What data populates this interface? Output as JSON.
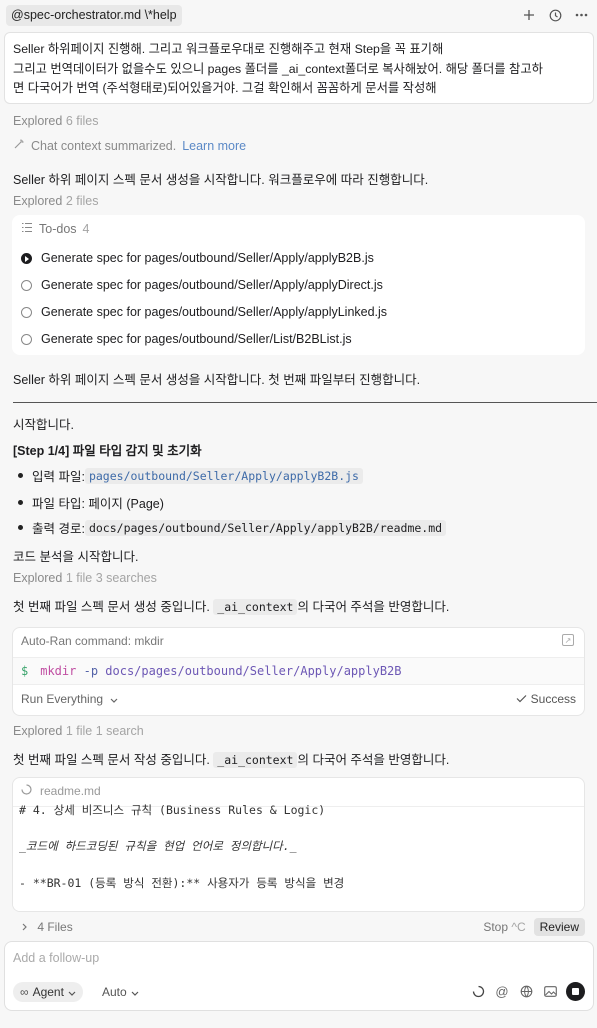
{
  "header": {
    "tab_title": "@spec-orchestrator.md \\*help",
    "icons": [
      "plus-icon",
      "history-icon",
      "more-icon"
    ]
  },
  "user_message": {
    "lines": [
      "Seller 하위페이지 진행해. 그리고 워크플로우대로 진행해주고 현재 Step을 꼭 표기해",
      "그리고 번역데이터가 없을수도 있으니 pages 폴더를 _ai_context폴더로 복사해놨어. 해당 폴더를 참고하",
      "면 다국어가 번역 (주석형태로)되어있을거야. 그걸 확인해서 꼼꼼하게 문서를 작성해"
    ]
  },
  "explored_1": {
    "label": "Explored",
    "detail": "6 files"
  },
  "summary": {
    "text": "Chat context summarized.",
    "link": "Learn more"
  },
  "msg_1": "Seller 하위 페이지 스펙 문서 생성을 시작합니다. 워크플로우에 따라 진행합니다.",
  "explored_2": {
    "label": "Explored",
    "detail": "2 files"
  },
  "todos": {
    "title": "To-dos",
    "count": "4",
    "items": [
      {
        "label": "Generate spec for pages/outbound/Seller/Apply/applyB2B.js",
        "state": "in-progress"
      },
      {
        "label": "Generate spec for pages/outbound/Seller/Apply/applyDirect.js",
        "state": "pending"
      },
      {
        "label": "Generate spec for pages/outbound/Seller/Apply/applyLinked.js",
        "state": "pending"
      },
      {
        "label": "Generate spec for pages/outbound/Seller/List/B2BList.js",
        "state": "pending"
      }
    ]
  },
  "msg_2": "Seller 하위 페이지 스펙 문서 생성을 시작합니다. 첫 번째 파일부터 진행합니다.",
  "start_text": "시작합니다.",
  "step_heading": "[Step 1/4] 파일 타입 감지 및 초기화",
  "bullets": [
    {
      "label": "입력 파일: ",
      "code": "pages/outbound/Seller/Apply/applyB2B.js"
    },
    {
      "label": "파일 타입: 페이지 (Page)",
      "code": ""
    },
    {
      "label": "출력 경로: ",
      "code": "docs/pages/outbound/Seller/Apply/applyB2B/readme.md"
    }
  ],
  "code_start": "코드 분석을 시작합니다.",
  "explored_3": {
    "label": "Explored",
    "detail": "1 file 3 searches"
  },
  "msg_3": {
    "prefix": "첫 번째 파일 스펙 문서 생성 중입니다.",
    "code": "_ai_context",
    "suffix": "의 다국어 주석을 반영합니다."
  },
  "command": {
    "header": "Auto-Ran command: mkdir",
    "prompt": "$",
    "cmd": "mkdir",
    "flag": "-p",
    "path": "docs/pages/outbound/Seller/Apply/applyB2B",
    "run_mode": "Run Everything",
    "status": "Success"
  },
  "explored_4": {
    "label": "Explored",
    "detail": "1 file 1 search"
  },
  "msg_4": {
    "prefix": "첫 번째 파일 스펙 문서 작성 중입니다.",
    "code": "_ai_context",
    "suffix": "의 다국어 주석을 반영합니다."
  },
  "file_preview": {
    "filename": "readme.md",
    "lines": [
      "# 4. 상세 비즈니스 규칙 (Business Rules & Logic)",
      "_코드에 하드코딩된 규칙을 현업 언어로 정의합니다._",
      "- **BR-01 (등록 방식 전환):** 사용자가 등록 방식을 변경"
    ]
  },
  "files_bar": {
    "label": "4 Files",
    "stop": "Stop",
    "stop_shortcut": "^C",
    "review": "Review"
  },
  "composer": {
    "placeholder": "Add a follow-up",
    "agent_label": "Agent",
    "model_label": "Auto"
  }
}
